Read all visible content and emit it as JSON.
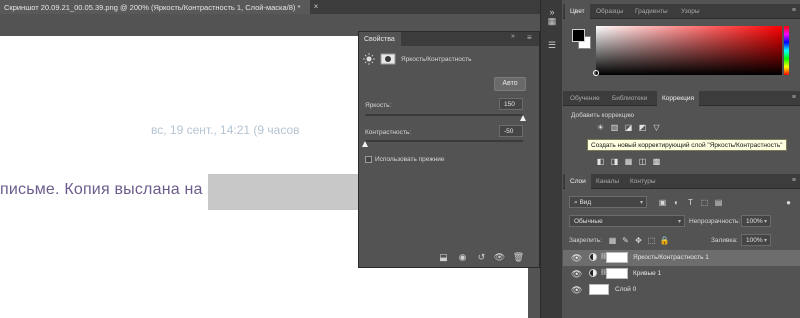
{
  "document": {
    "tab_title": "Скриншот 20.09.21_00.05.39.png @ 200% (Яркость/Контрастность 1, Слой-маска/8) *",
    "tab_close": "×",
    "date_text": "вс, 19 сент., 14:21 (9 часов",
    "letter_text": "письме. Копия выслана на"
  },
  "properties": {
    "tab_label": "Свойства",
    "collapse": "»",
    "menu": "≡",
    "title": "Яркость/Контрастность",
    "auto_button": "Авто",
    "brightness_label": "Яркость:",
    "brightness_value": "150",
    "brightness_fraction": 1.0,
    "contrast_label": "Контрастность:",
    "contrast_value": "-50",
    "contrast_fraction": 0.0,
    "legacy_label": "Использовать прежние"
  },
  "color_panel": {
    "tabs": [
      "Цвет",
      "Образцы",
      "Градиенты",
      "Узоры"
    ],
    "menu": "≡"
  },
  "adjustments_panel": {
    "tabs": [
      "Обучение",
      "Библиотеки",
      "Коррекция"
    ],
    "menu": "≡",
    "add_label": "Добавить коррекцию",
    "tooltip": "Создать новый корректирующий слой \"Яркость/Контрастность\""
  },
  "layers_panel": {
    "tabs": [
      "Слои",
      "Каналы",
      "Контуры"
    ],
    "menu": "≡",
    "filter_value": "Вид",
    "blend_mode": "Обычные",
    "opacity_label": "Непрозрачность:",
    "opacity_value": "100%",
    "lock_label": "Закрепить:",
    "fill_label": "Заливка:",
    "fill_value": "100%",
    "layers": [
      {
        "name": "Яркость/Контрастность 1",
        "selected": true
      },
      {
        "name": "Кривые 1",
        "selected": false
      },
      {
        "name": "Слой 0",
        "selected": false
      }
    ]
  },
  "colors": {
    "panel_bg": "#535353",
    "header_bg": "#3c3c3c",
    "tooltip_bg": "#ffffe1"
  }
}
